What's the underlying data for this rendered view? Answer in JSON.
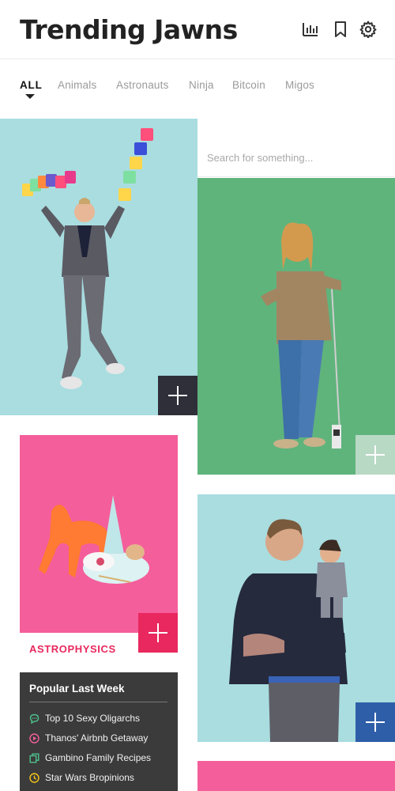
{
  "header": {
    "title": "Trending Jawns",
    "icons": [
      "bar-chart-icon",
      "bookmark-icon",
      "gear-icon"
    ]
  },
  "tabs": [
    {
      "label": "ALL",
      "active": true
    },
    {
      "label": "Animals",
      "active": false
    },
    {
      "label": "Astronauts",
      "active": false
    },
    {
      "label": "Ninja",
      "active": false
    },
    {
      "label": "Bitcoin",
      "active": false
    },
    {
      "label": "Migos",
      "active": false
    }
  ],
  "search": {
    "placeholder": "Search for something..."
  },
  "cards": {
    "juggler": {
      "bg": "#a9dde0",
      "add_color": "#2f2f3a"
    },
    "sweater_man": {
      "bg": "#5fb47c",
      "add_color": "#b8d9c4"
    },
    "dog_toy": {
      "bg": "#f45e9b",
      "category": "ASTROPHYSICS",
      "add_color": "#e8285e"
    },
    "puppet_man": {
      "bg": "#a9dde0",
      "add_color": "#2f5ea8"
    },
    "pink_bottom": {
      "bg": "#f45e9b"
    }
  },
  "popular": {
    "title": "Popular Last Week",
    "items": [
      {
        "label": "Top 10 Sexy Oligarchs",
        "icon": "chat-bubble-icon",
        "color": "#4fc08d"
      },
      {
        "label": "Thanos' Airbnb Getaway",
        "icon": "play-circle-icon",
        "color": "#f45e9b"
      },
      {
        "label": "Gambino Family Recipes",
        "icon": "copy-icon",
        "color": "#4fc08d"
      },
      {
        "label": "Star Wars Bropinions",
        "icon": "clock-icon",
        "color": "#f5c518"
      }
    ]
  }
}
